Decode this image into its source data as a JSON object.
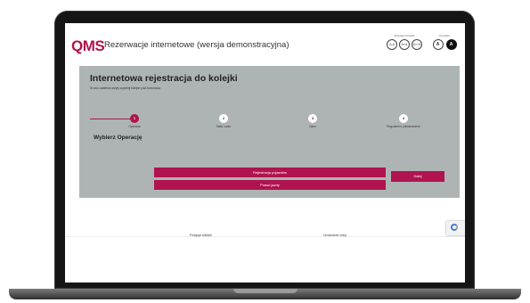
{
  "header": {
    "logo": "QMS",
    "title": "Rezerwacje internetowe (wersja demonstracyjna)",
    "font_size_label": "Rozmiar czcionki",
    "font_sizes": [
      "A-A",
      "A+A",
      "A++A"
    ],
    "contrast_label": "Kontrast",
    "contrast_options": [
      "A",
      "A"
    ]
  },
  "panel": {
    "title": "Internetowa rejestracja do kolejki",
    "subtitle": "W celu ustalenia wizyty wypełnij kolejne pola formularza",
    "section_title": "Wybierz Operację"
  },
  "stepper": {
    "current_step": 1,
    "steps": [
      {
        "number": "1",
        "label": "Operacja"
      },
      {
        "number": "2",
        "label": "Data i czas"
      },
      {
        "number": "3",
        "label": "Dane"
      },
      {
        "number": "4",
        "label": "Regulamin i potwierdzenie"
      }
    ]
  },
  "operations": [
    "Rejestracja pojazdów",
    "Prawo jazdy"
  ],
  "buttons": {
    "next": "Dalej"
  },
  "footer": {
    "links": [
      "Podgląd kolejek",
      "Umawianie wizyt"
    ]
  },
  "colors": {
    "accent": "#b0134f",
    "panel": "#aeb4b4"
  }
}
